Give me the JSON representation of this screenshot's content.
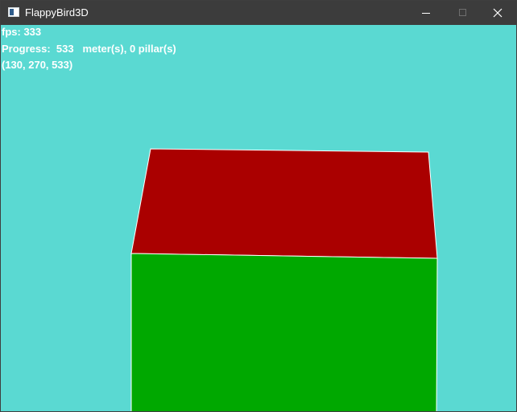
{
  "window": {
    "title": "FlappyBird3D",
    "icon": "app-window-icon",
    "controls": [
      "minimize-icon",
      "maximize-icon",
      "close-icon"
    ]
  },
  "hud": {
    "fps": "fps: 333",
    "progress": "Progress:  533   meter(s), 0 pillar(s)",
    "coords": "(130, 270, 533)"
  },
  "colors": {
    "sky": "#5ad9d2",
    "pillar_top": "#aa0000",
    "pillar_front": "#00a800",
    "hud_text": "#ffffff",
    "titlebar": "#3c3c3c"
  }
}
